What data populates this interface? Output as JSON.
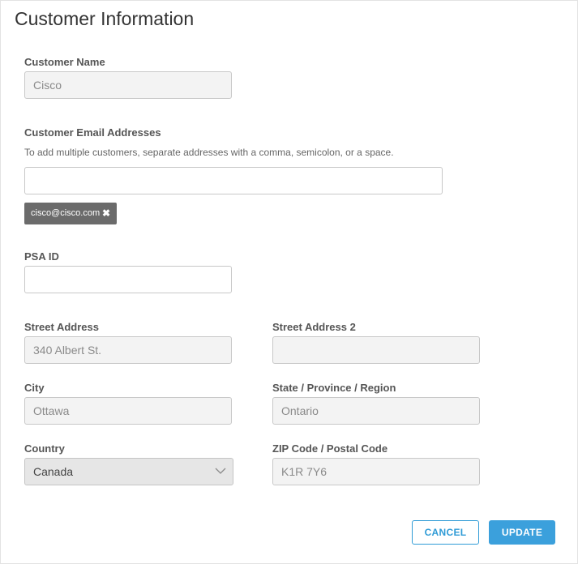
{
  "page": {
    "title": "Customer Information"
  },
  "customer_name": {
    "label": "Customer Name",
    "value": "Cisco"
  },
  "email": {
    "label": "Customer Email Addresses",
    "hint": "To add multiple customers, separate addresses with a comma, semicolon, or a space.",
    "value": "",
    "tags": [
      {
        "text": "cisco@cisco.com",
        "remove_glyph": "✖"
      }
    ]
  },
  "psa_id": {
    "label": "PSA ID",
    "value": ""
  },
  "street_address": {
    "label": "Street Address",
    "value": "340 Albert St."
  },
  "street_address_2": {
    "label": "Street Address 2",
    "value": ""
  },
  "city": {
    "label": "City",
    "value": "Ottawa"
  },
  "state": {
    "label": "State / Province / Region",
    "value": "Ontario"
  },
  "country": {
    "label": "Country",
    "value": "Canada",
    "icon": "chevron-down-icon"
  },
  "zip": {
    "label": "ZIP Code / Postal Code",
    "value": "K1R 7Y6"
  },
  "actions": {
    "cancel_label": "CANCEL",
    "update_label": "UPDATE"
  },
  "colors": {
    "accent": "#3ba0dc",
    "tag_bg": "#6b6b6b",
    "disabled_bg": "#f3f3f3"
  }
}
